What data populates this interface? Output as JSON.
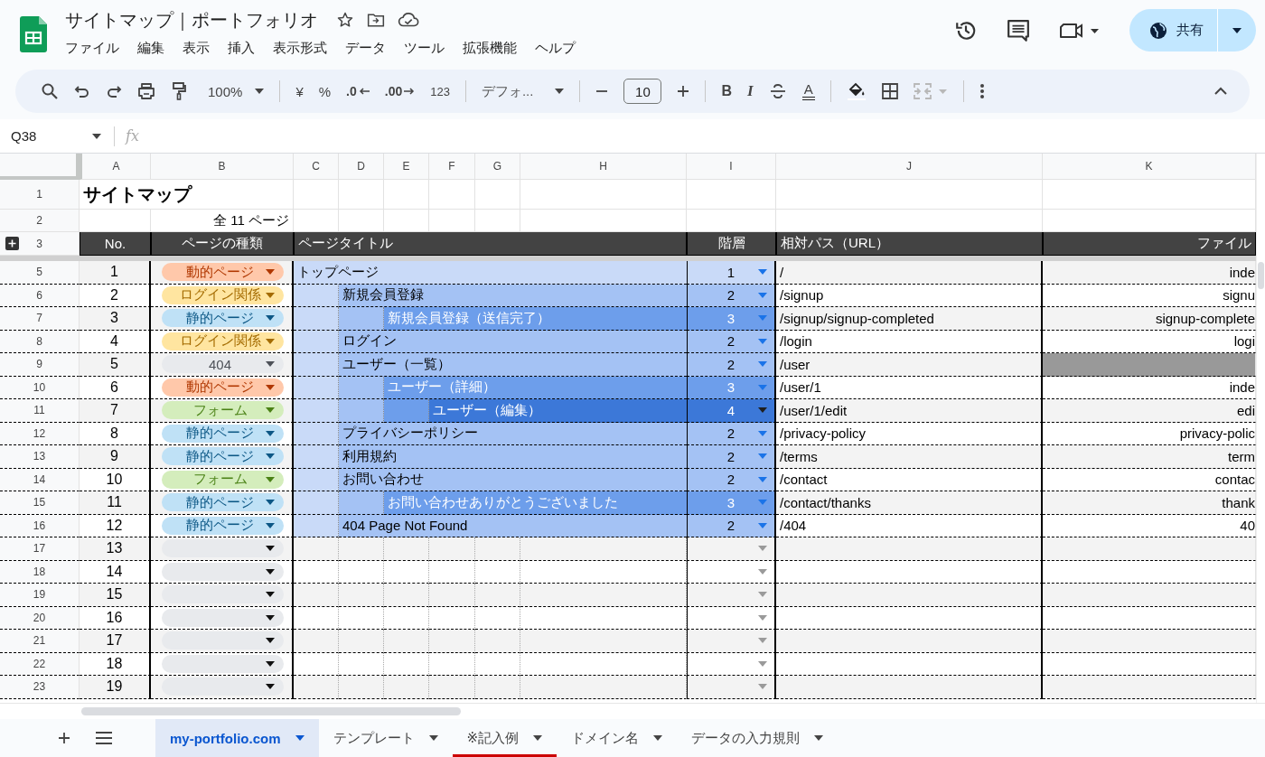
{
  "document": {
    "title": "サイトマップ｜ポートフォリオ"
  },
  "menu": [
    "ファイル",
    "編集",
    "表示",
    "挿入",
    "表示形式",
    "データ",
    "ツール",
    "拡張機能",
    "ヘルプ"
  ],
  "share_button": "共有",
  "toolbar": {
    "zoom": "100%",
    "currency": "¥",
    "percent": "%",
    "decrease_decimal": ".0",
    "increase_decimal": ".00",
    "number_format": "123",
    "font": "デフォ...",
    "font_size": "10",
    "bold": "B",
    "italic": "I",
    "text_color": "A"
  },
  "name_box": "Q38",
  "formula_label": "fx",
  "columns": [
    "A",
    "B",
    "C",
    "D",
    "E",
    "F",
    "G",
    "H",
    "I",
    "J",
    "K"
  ],
  "sheet": {
    "title_row": {
      "row": "1",
      "text": "サイトマップ"
    },
    "total_row": {
      "row": "2",
      "text": "全 11 ページ"
    },
    "header_row": {
      "row": "3",
      "cells": [
        "No.",
        "ページの種類",
        "ページタイトル",
        "階層",
        "相対パス（URL）",
        "ファイル"
      ]
    },
    "rows": [
      {
        "kind": "entry",
        "row": "5",
        "no": "1",
        "type": {
          "label": "動的ページ",
          "color": "#ffc8aa"
        },
        "title": "トップページ",
        "hierarchy": "1",
        "path": "/",
        "file": "inde",
        "file_shaded": false
      },
      {
        "kind": "entry",
        "row": "6",
        "no": "2",
        "type": {
          "label": "ログイン関係",
          "color": "#ffe5a0"
        },
        "title": "新規会員登録",
        "hierarchy": "2",
        "path": "/signup",
        "file": "signu",
        "file_shaded": false
      },
      {
        "kind": "entry",
        "row": "7",
        "no": "3",
        "type": {
          "label": "静的ページ",
          "color": "#bfe1f6"
        },
        "title": "新規会員登録（送信完了）",
        "hierarchy": "3",
        "path": "/signup/signup-completed",
        "file": "signup-complete",
        "file_shaded": false
      },
      {
        "kind": "entry",
        "row": "8",
        "no": "4",
        "type": {
          "label": "ログイン関係",
          "color": "#ffe5a0"
        },
        "title": "ログイン",
        "hierarchy": "2",
        "path": "/login",
        "file": "logi",
        "file_shaded": false
      },
      {
        "kind": "entry",
        "row": "9",
        "no": "5",
        "type": {
          "label": "404",
          "color": "#e8eaed"
        },
        "title": "ユーザー（一覧）",
        "hierarchy": "2",
        "path": "/user",
        "file_shaded": true
      },
      {
        "kind": "entry",
        "row": "10",
        "no": "6",
        "type": {
          "label": "動的ページ",
          "color": "#ffc8aa"
        },
        "title": "ユーザー（詳細）",
        "hierarchy": "3",
        "path": "/user/1",
        "file": "inde",
        "file_shaded": false
      },
      {
        "kind": "entry",
        "row": "11",
        "no": "7",
        "type": {
          "label": "フォーム",
          "color": "#d4edbc"
        },
        "title": "ユーザー（編集）",
        "hierarchy": "4",
        "path": "/user/1/edit",
        "file": "edi",
        "file_shaded": false
      },
      {
        "kind": "entry",
        "row": "12",
        "no": "8",
        "type": {
          "label": "静的ページ",
          "color": "#bfe1f6"
        },
        "title": "プライバシーポリシー",
        "hierarchy": "2",
        "path": "/privacy-policy",
        "file": "privacy-polic",
        "file_shaded": false
      },
      {
        "kind": "entry",
        "row": "13",
        "no": "9",
        "type": {
          "label": "静的ページ",
          "color": "#bfe1f6"
        },
        "title": "利用規約",
        "hierarchy": "2",
        "path": "/terms",
        "file": "term",
        "file_shaded": false
      },
      {
        "kind": "entry",
        "row": "14",
        "no": "10",
        "type": {
          "label": "フォーム",
          "color": "#d4edbc"
        },
        "title": "お問い合わせ",
        "hierarchy": "2",
        "path": "/contact",
        "file": "contac",
        "file_shaded": false
      },
      {
        "kind": "entry",
        "row": "15",
        "no": "11",
        "type": {
          "label": "静的ページ",
          "color": "#bfe1f6"
        },
        "title": "お問い合わせありがとうございました",
        "hierarchy": "3",
        "path": "/contact/thanks",
        "file": "thank",
        "file_shaded": false
      },
      {
        "kind": "entry",
        "row": "16",
        "no": "12",
        "type": {
          "label": "静的ページ",
          "color": "#bfe1f6"
        },
        "title": "404 Page Not Found",
        "hierarchy": "2",
        "path": "/404",
        "file": "40",
        "file_shaded": false
      },
      {
        "kind": "blank",
        "row": "17",
        "no": "13"
      },
      {
        "kind": "blank",
        "row": "18",
        "no": "14"
      },
      {
        "kind": "blank",
        "row": "19",
        "no": "15"
      },
      {
        "kind": "blank",
        "row": "20",
        "no": "16"
      },
      {
        "kind": "blank",
        "row": "21",
        "no": "17"
      },
      {
        "kind": "blank",
        "row": "22",
        "no": "18"
      },
      {
        "kind": "blank",
        "row": "23",
        "no": "19"
      }
    ]
  },
  "tabs": [
    {
      "label": "my-portfolio.com",
      "selected": true
    },
    {
      "label": "テンプレート",
      "selected": false
    },
    {
      "label": "※記入例",
      "selected": false,
      "color": "#cc0000"
    },
    {
      "label": "ドメイン名",
      "selected": false
    },
    {
      "label": "データの入力規則",
      "selected": false
    }
  ]
}
